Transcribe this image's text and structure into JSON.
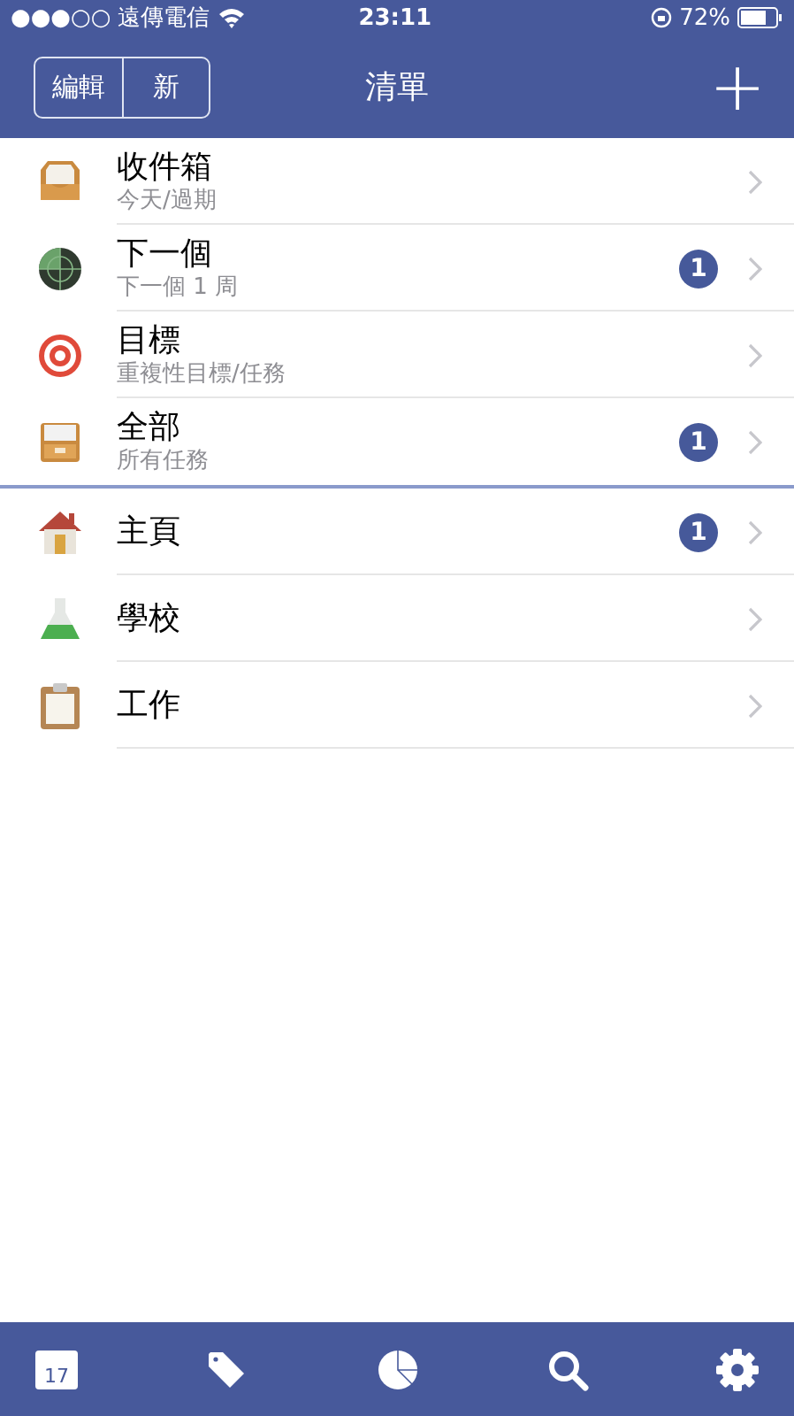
{
  "status_bar": {
    "signal": "●●●○○",
    "carrier": "遠傳電信",
    "time": "23:11",
    "battery": "72%"
  },
  "nav": {
    "segments": [
      "編輯",
      "新"
    ],
    "title": "清單",
    "add": "+"
  },
  "sections": [
    {
      "items": [
        {
          "kind": "inbox",
          "title": "收件箱",
          "subtitle": "今天/過期"
        },
        {
          "kind": "radar",
          "title": "下一個",
          "subtitle": "下一個 1 周",
          "badge": "1"
        },
        {
          "kind": "target",
          "title": "目標",
          "subtitle": "重複性目標/任務"
        },
        {
          "kind": "cabinet",
          "title": "全部",
          "subtitle": "所有任務",
          "badge": "1"
        }
      ]
    },
    {
      "items": [
        {
          "kind": "house",
          "title": "主頁",
          "badge": "1"
        },
        {
          "kind": "flask",
          "title": "學校"
        },
        {
          "kind": "clipboard",
          "title": "工作"
        }
      ]
    }
  ],
  "tab_bar": [
    {
      "kind": "calendar",
      "day": "17"
    },
    {
      "kind": "tag"
    },
    {
      "kind": "pie"
    },
    {
      "kind": "search"
    },
    {
      "kind": "settings"
    }
  ]
}
